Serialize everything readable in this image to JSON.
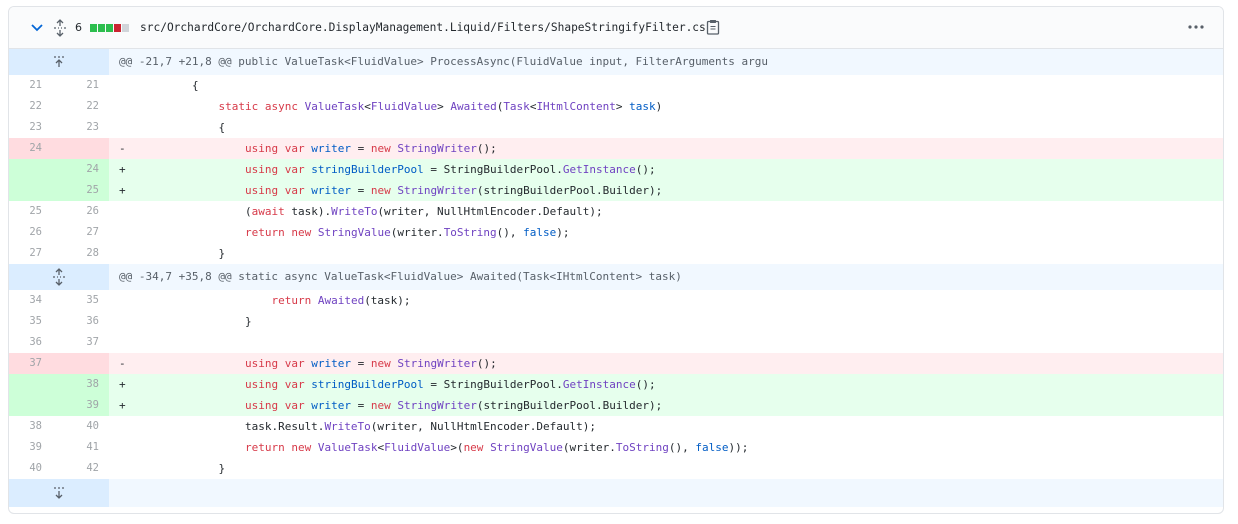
{
  "file": {
    "change_count": "6",
    "path": "src/OrchardCore/OrchardCore.DisplayManagement.Liquid/Filters/ShapeStringifyFilter.cs",
    "diffstat_colors": [
      "#2cbe4e",
      "#2cbe4e",
      "#2cbe4e",
      "#cb2431",
      "#d1d5da"
    ]
  },
  "hunks": [
    "@@ -21,7 +21,8 @@ public ValueTask<FluidValue> ProcessAsync(FluidValue input, FilterArguments argu",
    "@@ -34,7 +35,8 @@ static async ValueTask<FluidValue> Awaited(Task<IHtmlContent> task)"
  ],
  "lines": [
    {
      "old": "21",
      "new": "21",
      "type": "ctx",
      "marker": "",
      "code": "        {"
    },
    {
      "old": "22",
      "new": "22",
      "type": "ctx",
      "marker": "",
      "code": "            static async ValueTask<FluidValue> Awaited(Task<IHtmlContent> task)"
    },
    {
      "old": "23",
      "new": "23",
      "type": "ctx",
      "marker": "",
      "code": "            {"
    },
    {
      "old": "24",
      "new": "",
      "type": "del",
      "marker": "-",
      "code": "                using var writer = new StringWriter();"
    },
    {
      "old": "",
      "new": "24",
      "type": "add",
      "marker": "+",
      "code": "                using var stringBuilderPool = StringBuilderPool.GetInstance();"
    },
    {
      "old": "",
      "new": "25",
      "type": "add",
      "marker": "+",
      "code": "                using var writer = new StringWriter(stringBuilderPool.Builder);"
    },
    {
      "old": "25",
      "new": "26",
      "type": "ctx",
      "marker": "",
      "code": "                (await task).WriteTo(writer, NullHtmlEncoder.Default);"
    },
    {
      "old": "26",
      "new": "27",
      "type": "ctx",
      "marker": "",
      "code": "                return new StringValue(writer.ToString(), false);"
    },
    {
      "old": "27",
      "new": "28",
      "type": "ctx",
      "marker": "",
      "code": "            }"
    },
    {
      "old": "34",
      "new": "35",
      "type": "ctx",
      "marker": "",
      "code": "                    return Awaited(task);"
    },
    {
      "old": "35",
      "new": "36",
      "type": "ctx",
      "marker": "",
      "code": "                }"
    },
    {
      "old": "36",
      "new": "37",
      "type": "ctx",
      "marker": "",
      "code": ""
    },
    {
      "old": "37",
      "new": "",
      "type": "del",
      "marker": "-",
      "code": "                using var writer = new StringWriter();"
    },
    {
      "old": "",
      "new": "38",
      "type": "add",
      "marker": "+",
      "code": "                using var stringBuilderPool = StringBuilderPool.GetInstance();"
    },
    {
      "old": "",
      "new": "39",
      "type": "add",
      "marker": "+",
      "code": "                using var writer = new StringWriter(stringBuilderPool.Builder);"
    },
    {
      "old": "38",
      "new": "40",
      "type": "ctx",
      "marker": "",
      "code": "                task.Result.WriteTo(writer, NullHtmlEncoder.Default);"
    },
    {
      "old": "39",
      "new": "41",
      "type": "ctx",
      "marker": "",
      "code": "                return new ValueTask<FluidValue>(new StringValue(writer.ToString(), false));"
    },
    {
      "old": "40",
      "new": "42",
      "type": "ctx",
      "marker": "",
      "code": "            }"
    }
  ],
  "icons": {
    "collapse": "chevron-down-icon",
    "expand_all": "unfold-icon",
    "copy": "clipboard-icon",
    "more": "kebab-horizontal-icon",
    "expand_up": "fold-up-icon",
    "expand_both": "unfold-icon",
    "expand_down": "fold-down-icon"
  }
}
